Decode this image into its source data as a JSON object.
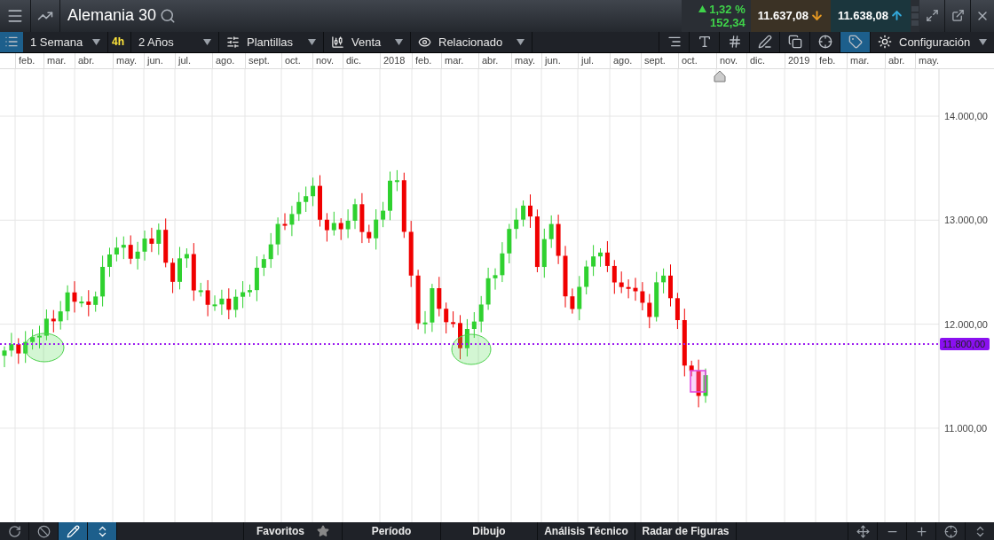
{
  "header": {
    "title": "Alemania 30",
    "change_percent": "1,32 %",
    "change_points": "152,34",
    "sell_price": "11.637,08",
    "buy_price": "11.638,08"
  },
  "toolbar": {
    "list_selected": true,
    "interval": "1 Semana",
    "interval_badge": "4h",
    "range": "2 Años",
    "templates": "Plantillas",
    "price_type": "Venta",
    "related": "Relacionado",
    "settings": "Configuración",
    "tools": [
      {
        "kind": "lines",
        "selected": false
      },
      {
        "kind": "text",
        "selected": false
      },
      {
        "kind": "grid",
        "selected": false
      },
      {
        "kind": "draw",
        "selected": false
      },
      {
        "kind": "windows",
        "selected": false
      },
      {
        "kind": "crosshair",
        "selected": false
      },
      {
        "kind": "tag",
        "selected": true
      }
    ]
  },
  "chart": {
    "months": [
      "feb.",
      "mar.",
      "abr.",
      "may.",
      "jun.",
      "jul.",
      "ago.",
      "sept.",
      "oct.",
      "nov.",
      "dic.",
      "2018",
      "feb.",
      "mar.",
      "abr.",
      "may.",
      "jun.",
      "jul.",
      "ago.",
      "sept.",
      "oct.",
      "nov.",
      "dic.",
      "2019",
      "feb.",
      "mar.",
      "abr.",
      "may."
    ],
    "price_labels": [
      "14.000,00",
      "13.000,00",
      "12.000,00",
      "11.000,00"
    ],
    "level_line": "11.800,00"
  },
  "bottom_bar": {
    "tools": [
      {
        "kind": "refresh",
        "selected": false
      },
      {
        "kind": "ban",
        "selected": false
      },
      {
        "kind": "pencil",
        "selected": true
      },
      {
        "kind": "updown",
        "selected": true
      }
    ],
    "tabs": [
      {
        "label": "Favoritos",
        "kind": "favorites"
      },
      {
        "label": "Período",
        "kind": "menu"
      },
      {
        "label": "Dibujo",
        "kind": "menu"
      },
      {
        "label": "Análisis Técnico",
        "kind": "menu"
      },
      {
        "label": "Radar de Figuras",
        "kind": "menu"
      }
    ],
    "zoom_tools": [
      {
        "kind": "fit"
      },
      {
        "kind": "minus"
      },
      {
        "kind": "plus"
      },
      {
        "kind": "cross"
      },
      {
        "kind": "vertical"
      }
    ]
  }
}
